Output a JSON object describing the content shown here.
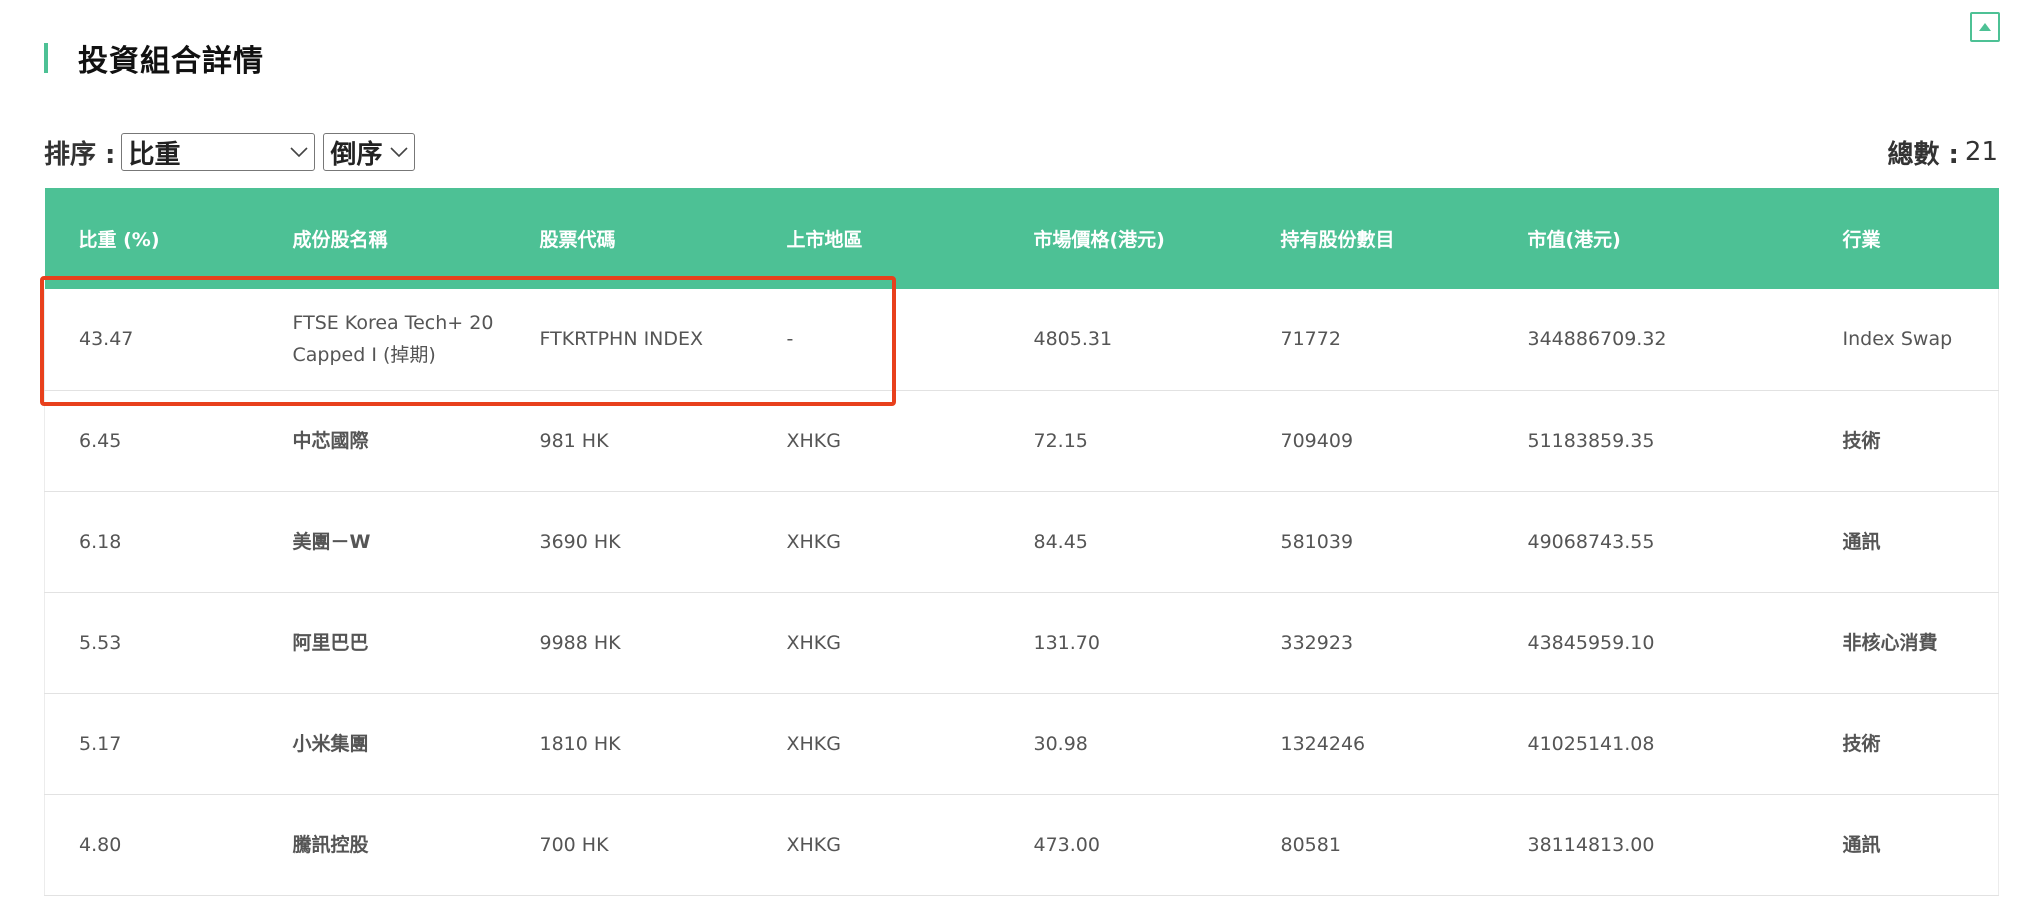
{
  "section": {
    "title": "投資組合詳情"
  },
  "controls": {
    "sort_label": "排序 :",
    "sort_field": "比重",
    "sort_order": "倒序",
    "total_label": "總數 :",
    "total_value": "21"
  },
  "table": {
    "headers": [
      "比重 (%)",
      "成份股名稱",
      "股票代碼",
      "上市地區",
      "市場價格(港元)",
      "持有股份數目",
      "市值(港元)",
      "行業"
    ],
    "rows": [
      {
        "weight": "43.47",
        "name": "FTSE Korea Tech+ 20 Capped I (掉期)",
        "code": "FTKRTPHN INDEX",
        "market": "-",
        "price": "4805.31",
        "shares": "71772",
        "value": "344886709.32",
        "industry": "Index Swap"
      },
      {
        "weight": "6.45",
        "name": "中芯國際",
        "code": "981 HK",
        "market": "XHKG",
        "price": "72.15",
        "shares": "709409",
        "value": "51183859.35",
        "industry": "技術"
      },
      {
        "weight": "6.18",
        "name": "美團－W",
        "code": "3690 HK",
        "market": "XHKG",
        "price": "84.45",
        "shares": "581039",
        "value": "49068743.55",
        "industry": "通訊"
      },
      {
        "weight": "5.53",
        "name": "阿里巴巴",
        "code": "9988 HK",
        "market": "XHKG",
        "price": "131.70",
        "shares": "332923",
        "value": "43845959.10",
        "industry": "非核心消費"
      },
      {
        "weight": "5.17",
        "name": "小米集團",
        "code": "1810 HK",
        "market": "XHKG",
        "price": "30.98",
        "shares": "1324246",
        "value": "41025141.08",
        "industry": "技術"
      },
      {
        "weight": "4.80",
        "name": "騰訊控股",
        "code": "700 HK",
        "market": "XHKG",
        "price": "473.00",
        "shares": "80581",
        "value": "38114813.00",
        "industry": "通訊"
      }
    ]
  },
  "icons": {
    "scroll_top": "triangle-up-icon",
    "dropdown": "chevron-down-icon"
  },
  "colors": {
    "accent": "#4dc195",
    "highlight": "#e8401c"
  }
}
